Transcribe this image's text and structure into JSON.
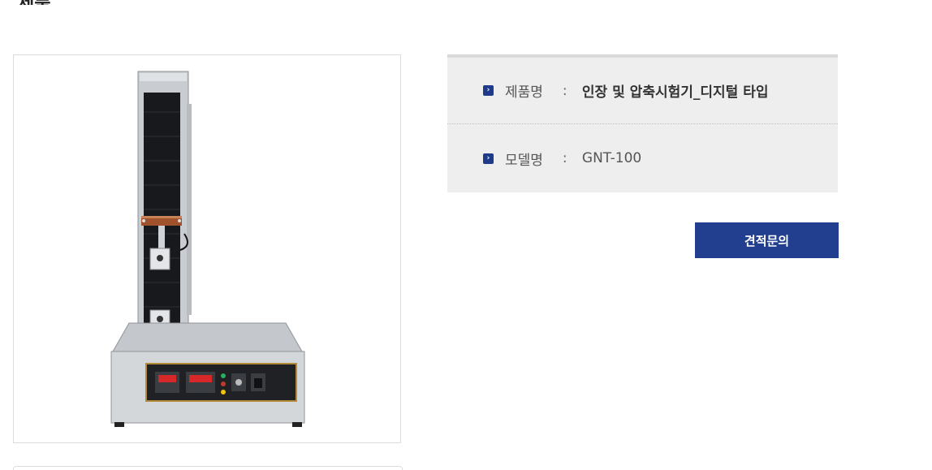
{
  "product": {
    "name_label": "제품명",
    "name_value": "인장 및 압축시험기_디지털 타입",
    "model_label": "모델명",
    "model_value": "GNT-100",
    "separator": ":"
  },
  "actions": {
    "quote_label": "견적문의"
  },
  "icons": {
    "bullet": "chevron-right-icon"
  },
  "colors": {
    "accent": "#213e8f",
    "info_background": "#eeeeee",
    "border": "#dcdcdc"
  }
}
